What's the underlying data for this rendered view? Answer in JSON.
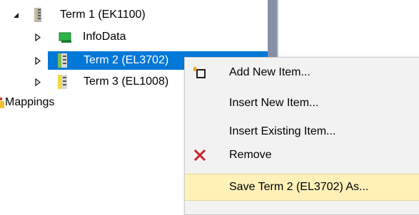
{
  "tree": {
    "items": [
      {
        "label": "Term 1 (EK1100)",
        "icon": "terminal-coupler-icon",
        "expander": "expanded-triangle"
      },
      {
        "label": "InfoData",
        "icon": "infodata-icon",
        "expander": "collapsed-triangle"
      },
      {
        "label": "Term 2 (EL3702)",
        "icon": "terminal-icon",
        "expander": "collapsed-triangle",
        "selected": true
      },
      {
        "label": "Term 3 (EL1008)",
        "icon": "terminal-icon",
        "expander": "collapsed-triangle"
      },
      {
        "label": "Mappings",
        "icon": "mappings-icon"
      }
    ]
  },
  "context_menu": {
    "items": [
      {
        "label": "Add New Item...",
        "icon": "add-new-item-icon"
      },
      {
        "label": "Insert New Item..."
      },
      {
        "label": "Insert Existing Item..."
      },
      {
        "label": "Remove",
        "icon": "remove-x-icon"
      },
      {
        "label": "Save Term 2 (EL3702) As...",
        "highlighted": true
      }
    ]
  },
  "colors": {
    "selection": "#0078d7",
    "menu_background": "#f2f2f2",
    "menu_highlight": "#fff1b8",
    "remove_icon": "#c8262d",
    "splitter": "#8590a6"
  }
}
